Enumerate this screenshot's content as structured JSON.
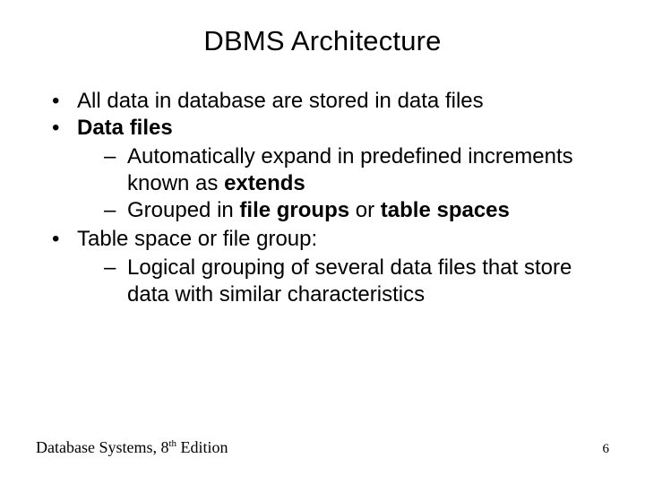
{
  "title": "DBMS Architecture",
  "bullets": {
    "b1": "All data in database are stored in data files",
    "b2": "Data files",
    "b2_sub1_pre": "Automatically expand in predefined increments known as ",
    "b2_sub1_bold": "extends",
    "b2_sub2_pre": "Grouped in ",
    "b2_sub2_bold1": "file groups",
    "b2_sub2_mid": " or ",
    "b2_sub2_bold2": "table spaces",
    "b3": "Table space or file group:",
    "b3_sub1": "Logical grouping of several data files that store data with similar characteristics"
  },
  "footer": {
    "book_prefix": "Database Systems, 8",
    "book_sup": "th",
    "book_suffix": " Edition",
    "page": "6"
  }
}
